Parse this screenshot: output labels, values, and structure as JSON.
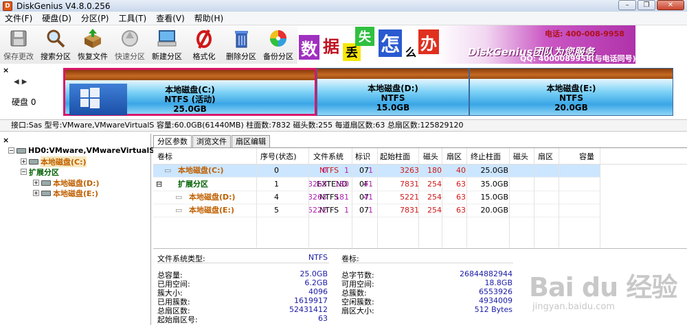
{
  "window": {
    "title": "DiskGenius V4.8.0.256",
    "app_icon": "D"
  },
  "menu": [
    "文件(F)",
    "硬盘(D)",
    "分区(P)",
    "工具(T)",
    "查看(V)",
    "帮助(H)"
  ],
  "toolbar": {
    "save": "保存更改",
    "search": "搜索分区",
    "recover": "恢复文件",
    "quick": "快速分区",
    "new": "新建分区",
    "format": "格式化",
    "delete": "删除分区",
    "backup": "备份分区"
  },
  "banner": {
    "chars": [
      "数",
      "据",
      "丢",
      "失",
      "怎",
      "么",
      "办"
    ],
    "brand": "DiskGenius团队为您服务",
    "phone": "电话: 400-008-9958",
    "qq": "QQ: 4000089958(与电话同号)"
  },
  "disk": {
    "label": "硬盘 0",
    "close": "×",
    "nav": "◀▶"
  },
  "partitions": [
    {
      "name": "本地磁盘(C:)",
      "fs": "NTFS (活动)",
      "size": "25.0GB"
    },
    {
      "name": "本地磁盘(D:)",
      "fs": "NTFS",
      "size": "15.0GB"
    },
    {
      "name": "本地磁盘(E:)",
      "fs": "NTFS",
      "size": "20.0GB"
    }
  ],
  "infobar": "接口:Sas  型号:VMware,VMwareVirtualS  容量:60.0GB(61440MB)  柱面数:7832  磁头数:255  每道扇区数:63  总扇区数:125829120",
  "tree": {
    "close": "×",
    "root": "HD0:VMware,VMwareVirtualS",
    "c": "本地磁盘(C:)",
    "ext": "扩展分区",
    "d": "本地磁盘(D:)",
    "e": "本地磁盘(E:)"
  },
  "tabs": [
    "分区参数",
    "浏览文件",
    "扇区编辑"
  ],
  "table": {
    "headers": [
      "卷标",
      "序号(状态)",
      "文件系统",
      "标识",
      "起始柱面",
      "磁头",
      "扇区",
      "终止柱面",
      "磁头",
      "扇区",
      "容量"
    ],
    "rows": [
      [
        "本地磁盘(C:)",
        "0",
        "NTFS",
        "07",
        "0",
        "1",
        "1",
        "3263",
        "180",
        "40",
        "25.0GB"
      ],
      [
        "扩展分区",
        "1",
        "EXTEND",
        "0F",
        "3263",
        "180",
        "41",
        "7831",
        "254",
        "63",
        "35.0GB"
      ],
      [
        "本地磁盘(D:)",
        "4",
        "NTFS",
        "07",
        "3263",
        "181",
        "41",
        "5221",
        "254",
        "63",
        "15.0GB"
      ],
      [
        "本地磁盘(E:)",
        "5",
        "NTFS",
        "07",
        "5222",
        "1",
        "1",
        "7831",
        "254",
        "63",
        "20.0GB"
      ]
    ]
  },
  "details": {
    "fs_type_label": "文件系统类型:",
    "fs_type": "NTFS",
    "vol_label": "卷标:",
    "left": [
      [
        "总容量:",
        "25.0GB"
      ],
      [
        "已用空间:",
        "6.2GB"
      ],
      [
        "簇大小:",
        "4096"
      ],
      [
        "已用簇数:",
        "1619917"
      ],
      [
        "总扇区数:",
        "52431412"
      ],
      [
        "起始扇区号:",
        "63"
      ]
    ],
    "right": [
      [
        "总字节数:",
        "26844882944"
      ],
      [
        "可用空间:",
        "18.8GB"
      ],
      [
        "总簇数:",
        "6553926"
      ],
      [
        "空闲簇数:",
        "4934009"
      ],
      [
        "扇区大小:",
        "512 Bytes"
      ]
    ]
  },
  "watermark": {
    "main": "Bai du 经验",
    "sub": "jingyan.baidu.com"
  },
  "colors": {
    "active_border": "#d8186a",
    "value_blue": "#1a1aa8",
    "selected_row": "#cce6ff",
    "tree_orange": "#c06000",
    "tree_green": "#006000"
  }
}
